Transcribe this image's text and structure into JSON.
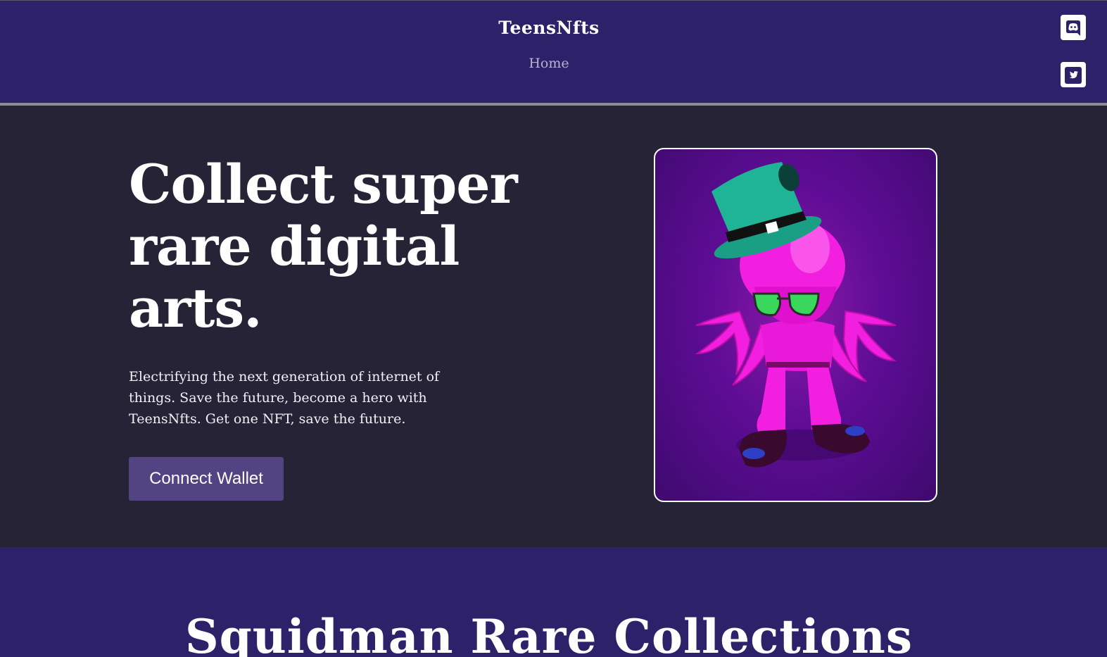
{
  "header": {
    "brand": "TeensNfts",
    "nav": {
      "home": "Home"
    },
    "social": [
      {
        "icon": "discord-icon"
      },
      {
        "icon": "twitter-icon"
      }
    ]
  },
  "hero": {
    "title": "Collect super rare digital arts.",
    "description": "Electrifying the next generation of internet of things. Save the future, become a hero with TeensNfts. Get one NFT, save the future.",
    "cta_label": "Connect Wallet"
  },
  "collections": {
    "title": "Squidman Rare Collections"
  },
  "colors": {
    "header_bg": "#2d2169",
    "hero_bg": "#252335",
    "button_bg": "#524383",
    "art_pink": "#f21ee0",
    "art_hat": "#1fb496"
  }
}
